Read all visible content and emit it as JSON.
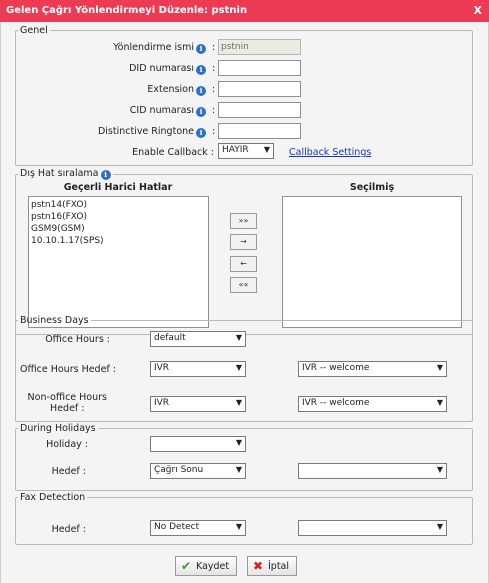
{
  "dialog": {
    "title": "Gelen Çağrı Yönlendirmeyi Düzenle: pstnin",
    "close_label": "X"
  },
  "genel": {
    "legend": "Genel",
    "route_name_label": "Yönlendirme ismi",
    "route_name_value": "pstnin",
    "did_label": "DID numarası",
    "did_value": "",
    "extension_label": "Extension",
    "extension_value": "",
    "cid_label": "CID numarası",
    "cid_value": "",
    "ringtone_label": "Distinctive Ringtone",
    "ringtone_value": "",
    "callback_label": "Enable Callback :",
    "callback_value": "HAYIR",
    "callback_settings_link": "Callback Settings",
    "colon": ":"
  },
  "trunks": {
    "legend": "Dış Hat sıralama",
    "available_header": "Geçerli Harici Hatlar",
    "selected_header": "Seçilmiş",
    "available": [
      "pstn14(FXO)",
      "pstn16(FXO)",
      "GSM9(GSM)",
      "10.10.1.17(SPS)"
    ],
    "selected": [],
    "btn_all_right": "»»",
    "btn_right": "→",
    "btn_left": "←",
    "btn_all_left": "««"
  },
  "business": {
    "legend": "Business Days",
    "office_hours_label": "Office Hours :",
    "office_hours_value": "default",
    "oh_dest_label": "Office Hours Hedef :",
    "oh_dest_type": "IVR",
    "oh_dest_value": "IVR -- welcome",
    "noh_dest_label_line1": "Non-office Hours",
    "noh_dest_label_line2": "Hedef :",
    "noh_dest_type": "IVR",
    "noh_dest_value": "IVR -- welcome"
  },
  "holidays": {
    "legend": "During Holidays",
    "holiday_label": "Holiday :",
    "holiday_value": "",
    "dest_label": "Hedef :",
    "dest_type": "Çağrı Sonu",
    "dest_value": ""
  },
  "fax": {
    "legend": "Fax Detection",
    "dest_label": "Hedef :",
    "dest_type": "No Detect",
    "dest_value": ""
  },
  "actions": {
    "save_label": "Kaydet",
    "cancel_label": "İptal"
  },
  "icons": {
    "info": "i",
    "arrow": "▼",
    "save": "✔",
    "cancel": "✖"
  },
  "colors": {
    "titlebar": "#ee3b54",
    "link": "#1a33c8",
    "info": "#2d6fc4",
    "save_icon": "#3a9a2a",
    "cancel_icon": "#d42020"
  }
}
